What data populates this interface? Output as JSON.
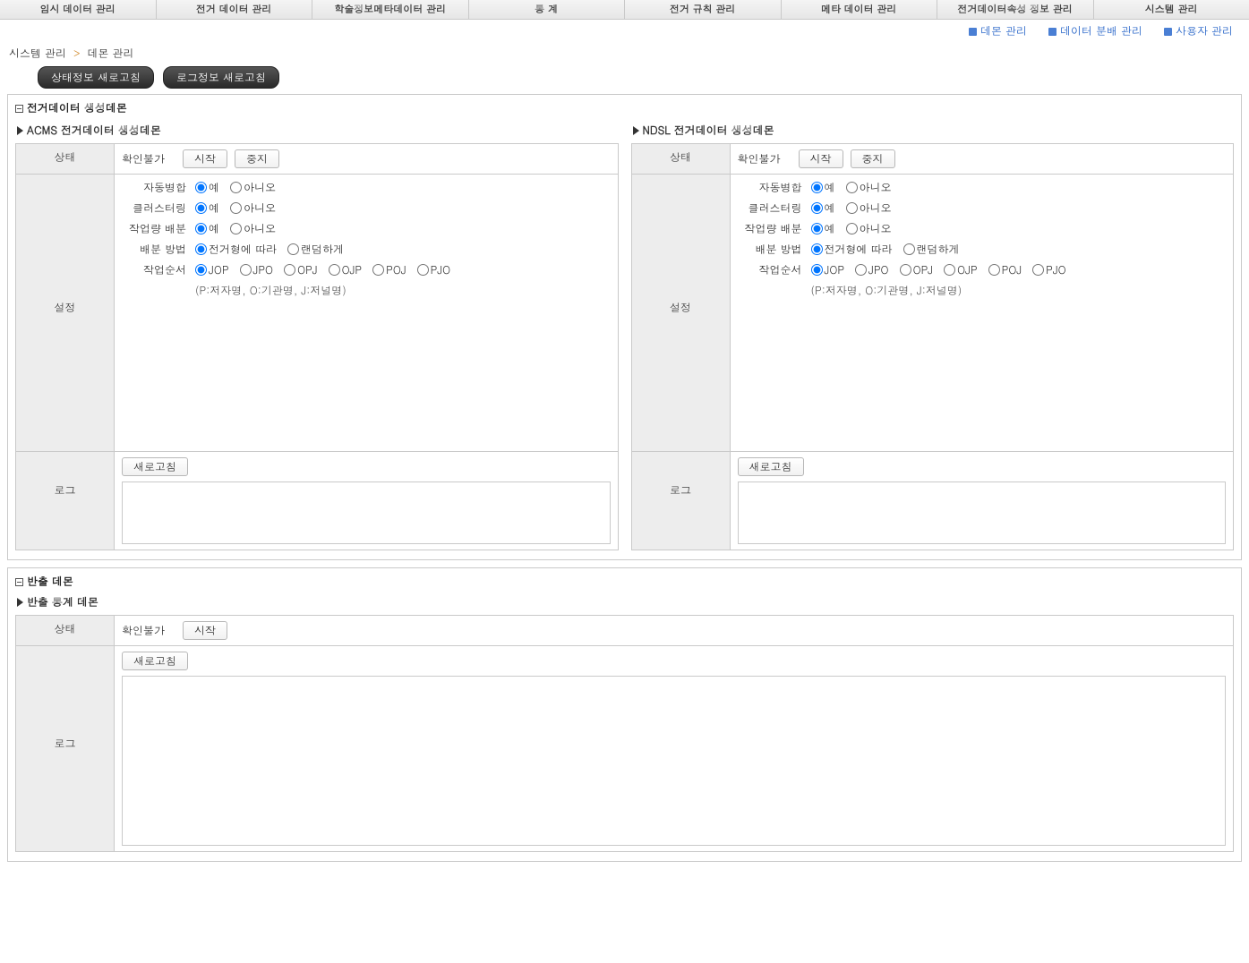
{
  "topnav": [
    "임시 데이터 관리",
    "전거 데이터 관리",
    "학술정보메타데이터 관리",
    "통    계",
    "전거 규칙 관리",
    "메타 데이터 관리",
    "전거데이터속성 정보 관리",
    "시스템 관리"
  ],
  "sublinks": [
    "데몬 관리",
    "데이터 분배 관리",
    "사용자 관리"
  ],
  "crumb": {
    "a": "시스템 관리",
    "sep": ">",
    "b": "데몬 관리"
  },
  "pills": {
    "status": "상태정보 새로고침",
    "log": "로그정보 새로고침"
  },
  "section1": {
    "title": "전거데이터 생성데몬"
  },
  "labels": {
    "status": "상태",
    "settings": "설정",
    "log": "로그",
    "start": "시작",
    "stop": "중지",
    "refresh": "새로고침",
    "autoMerge": "자동병합",
    "clustering": "클러스터링",
    "workDist": "작업량 배분",
    "distMethod": "배분 방법",
    "workOrder": "작업순서",
    "yes": "예",
    "no": "아니오",
    "byType": "전거형에 따라",
    "random": "랜덤하게",
    "orderHint": "(P:저자명, O:기관명, J:저널명)"
  },
  "statusValue": "확인불가",
  "orderOptions": [
    "JOP",
    "JPO",
    "OPJ",
    "OJP",
    "POJ",
    "PJO"
  ],
  "acms": {
    "title": "ACMS 전거데이터 생성데몬"
  },
  "ndsl": {
    "title": "NDSL 전거데이터 생성데몬"
  },
  "section2": {
    "title": "반출 데몬"
  },
  "export": {
    "title": "반출 통계 데몬"
  }
}
